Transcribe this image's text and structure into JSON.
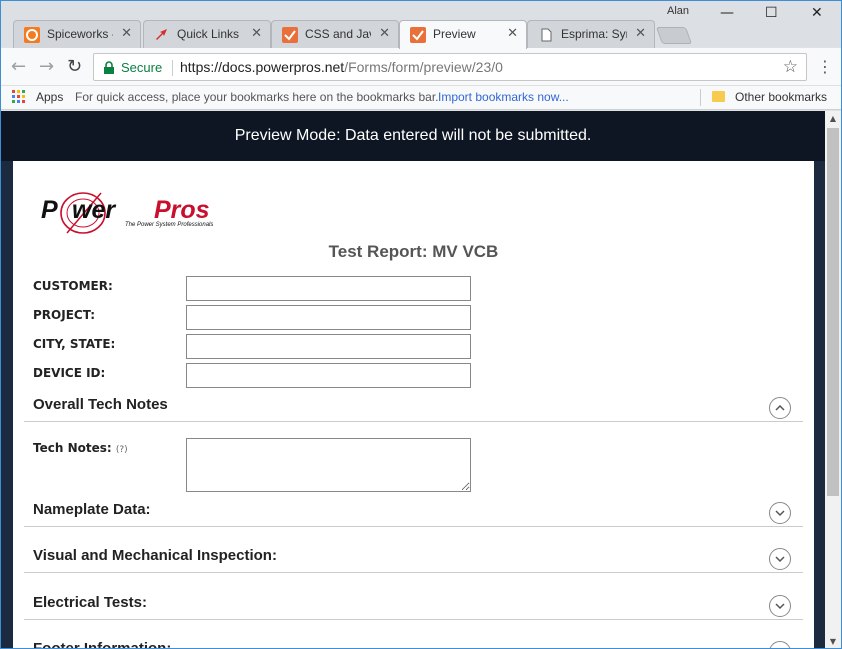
{
  "browser": {
    "tabs": [
      {
        "title": "Spiceworks -",
        "favicon_color": "#f47b20"
      },
      {
        "title": "Quick Links",
        "favicon_color": "#ffffff"
      },
      {
        "title": "CSS and Java",
        "favicon_color": "#e8703a"
      },
      {
        "title": "Preview",
        "favicon_color": "#e8703a"
      },
      {
        "title": "Esprima: Syn",
        "favicon_color": "#ffffff"
      }
    ],
    "close_glyph": "✕",
    "user_name": "Alan",
    "window_controls": {
      "minimize": "—",
      "maximize": "☐",
      "close": "✕"
    },
    "nav": {
      "back": "←",
      "forward": "→",
      "reload": "↻"
    },
    "secure_label": "Secure",
    "url_host": "https://docs.powerpros.net",
    "url_path": "/Forms/form/preview/23/0",
    "star_glyph": "☆",
    "menu_glyph": "⋮",
    "bookmarks": {
      "apps_label": "Apps",
      "hint": "For quick access, place your bookmarks here on the bookmarks bar.",
      "import_link": "Import bookmarks now...",
      "other": "Other bookmarks"
    }
  },
  "page": {
    "banner": "Preview Mode: Data entered will not be submitted.",
    "form_title": "Test Report: MV VCB",
    "fields": [
      {
        "label": "CUSTOMER:",
        "value": ""
      },
      {
        "label": "PROJECT:",
        "value": ""
      },
      {
        "label": "CITY, STATE:",
        "value": ""
      },
      {
        "label": "DEVICE ID:",
        "value": ""
      }
    ],
    "sections": [
      {
        "title": "Overall Tech Notes",
        "expanded": true
      },
      {
        "title": "Nameplate Data:",
        "expanded": false
      },
      {
        "title": "Visual and Mechanical Inspection:",
        "expanded": false
      },
      {
        "title": "Electrical Tests:",
        "expanded": false
      },
      {
        "title": "Footer Information:",
        "expanded": false
      }
    ],
    "tech_notes": {
      "label": "Tech Notes:",
      "help": "(?)",
      "value": ""
    }
  },
  "colors": {
    "banner_bg": "#0e1624",
    "frame_bg": "#1c2a3f",
    "logo_red": "#c8102e"
  },
  "icons": [
    "spiceworks-icon",
    "quick-links-icon",
    "check-icon",
    "document-icon",
    "lock-icon",
    "star-icon",
    "apps-icon",
    "folder-icon",
    "chevron-up-icon",
    "chevron-down-icon"
  ]
}
